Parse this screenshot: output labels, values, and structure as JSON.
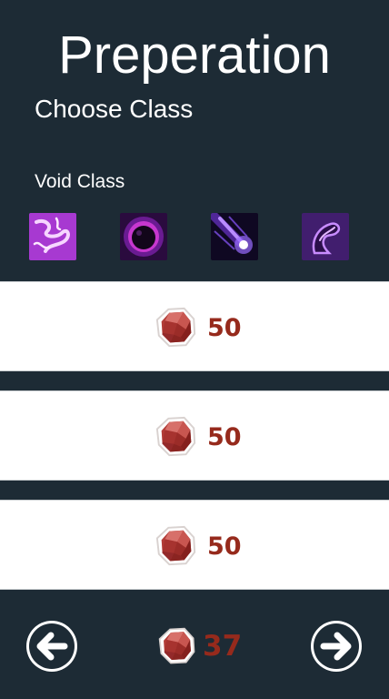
{
  "header": {
    "title": "Preperation",
    "subtitle": "Choose Class",
    "class_name": "Void Class"
  },
  "skills": [
    {
      "icon": "void-lightning-skill-icon"
    },
    {
      "icon": "void-orb-skill-icon"
    },
    {
      "icon": "void-meteor-skill-icon"
    },
    {
      "icon": "void-claw-skill-icon"
    }
  ],
  "options": [
    {
      "cost": "50",
      "icon": "red-gem-icon"
    },
    {
      "cost": "50",
      "icon": "red-gem-icon"
    },
    {
      "cost": "50",
      "icon": "red-gem-icon"
    }
  ],
  "footer": {
    "currency_amount": "37",
    "back_icon": "arrow-left-icon",
    "next_icon": "arrow-right-icon"
  },
  "colors": {
    "background": "#1d2b35",
    "card": "#ffffff",
    "price_text": "#962a1c",
    "gem": "#b9443f"
  }
}
